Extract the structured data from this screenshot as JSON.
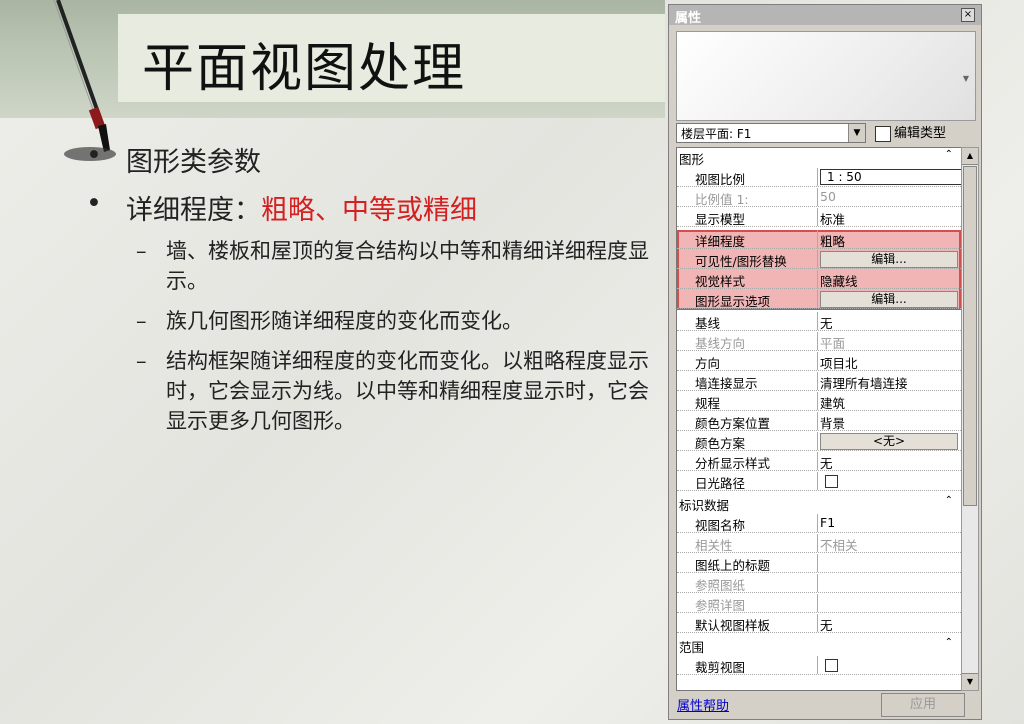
{
  "slide": {
    "title": "平面视图处理",
    "bullets": [
      {
        "text": "图形类参数"
      },
      {
        "text_prefix": "详细程度：",
        "text_highlight": "粗略、中等或精细"
      }
    ],
    "sub_bullets": [
      "墙、楼板和屋顶的复合结构以中等和精细详细程度显示。",
      "族几何图形随详细程度的变化而变化。",
      "结构框架随详细程度的变化而变化。以粗略程度显示时，它会显示为线。以中等和精细程度显示时，它会显示更多几何图形。"
    ],
    "accent_color": "#d42020"
  },
  "panel": {
    "title": "属性",
    "close": "×",
    "selector_value": "楼层平面: F1",
    "edit_type_label": "编辑类型",
    "help_link": "属性帮助",
    "apply_label": "应用",
    "highlight_color": "#e67878"
  },
  "properties": {
    "group_graphics": "图形",
    "view_scale_label": "视图比例",
    "view_scale_value": "1 : 50",
    "scale_value_label": "比例值 1:",
    "scale_value": "50",
    "display_model_label": "显示模型",
    "display_model_value": "标准",
    "detail_level_label": "详细程度",
    "detail_level_value": "粗略",
    "visibility_label": "可见性/图形替换",
    "visibility_value": "编辑...",
    "visual_style_label": "视觉样式",
    "visual_style_value": "隐藏线",
    "graphic_display_label": "图形显示选项",
    "graphic_display_value": "编辑...",
    "underlay_label": "基线",
    "underlay_value": "无",
    "underlay_orient_label": "基线方向",
    "underlay_orient_value": "平面",
    "orientation_label": "方向",
    "orientation_value": "项目北",
    "wall_join_label": "墙连接显示",
    "wall_join_value": "清理所有墙连接",
    "discipline_label": "规程",
    "discipline_value": "建筑",
    "color_loc_label": "颜色方案位置",
    "color_loc_value": "背景",
    "color_scheme_label": "颜色方案",
    "color_scheme_value": "<无>",
    "analysis_label": "分析显示样式",
    "analysis_value": "无",
    "sun_path_label": "日光路径",
    "group_identity": "标识数据",
    "view_name_label": "视图名称",
    "view_name_value": "F1",
    "dependency_label": "相关性",
    "dependency_value": "不相关",
    "title_on_sheet_label": "图纸上的标题",
    "ref_sheet_label": "参照图纸",
    "ref_detail_label": "参照详图",
    "default_template_label": "默认视图样板",
    "default_template_value": "无",
    "group_extents": "范围",
    "crop_view_label": "裁剪视图"
  }
}
